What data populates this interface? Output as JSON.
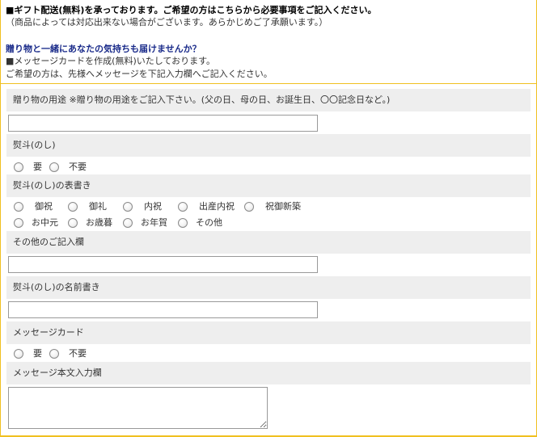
{
  "intro": {
    "line1": "■ギフト配送(無料)を承っております。ご希望の方はこちらから必要事項をご記入ください。",
    "line2": "（商品によっては対応出来ない場合がございます。あらかじめご了承願います。）",
    "line3": "贈り物と一緒にあなたの気持ちも届けませんか？",
    "line4": "■メッセージカードを作成(無料)いたしております。",
    "line5": "ご希望の方は、先様へメッセージを下記入力欄へご記入ください。"
  },
  "form": {
    "purpose_label": "贈り物の用途 ※贈り物の用途をご記入下さい。(父の日、母の日、お誕生日、〇〇記念日など。)",
    "purpose_value": "",
    "noshi_label": "熨斗(のし)",
    "noshi_options": [
      "要",
      "不要"
    ],
    "omotegaki_label": "熨斗(のし)の表書き",
    "omotegaki_options_row1": [
      "御祝",
      "御礼",
      "内祝",
      "出産内祝",
      "祝御新築"
    ],
    "omotegaki_options_row2": [
      "お中元",
      "お歳暮",
      "お年賀",
      "その他"
    ],
    "other_label": "その他のご記入欄",
    "other_value": "",
    "namegaki_label": "熨斗(のし)の名前書き",
    "namegaki_value": "",
    "card_label": "メッセージカード",
    "card_options": [
      "要",
      "不要"
    ],
    "message_label": "メッセージ本文入力欄",
    "message_value": ""
  },
  "colors": {
    "border_accent": "#f0c020",
    "label_bg": "#eeeeee",
    "heading_navy": "#1a2b8a"
  }
}
